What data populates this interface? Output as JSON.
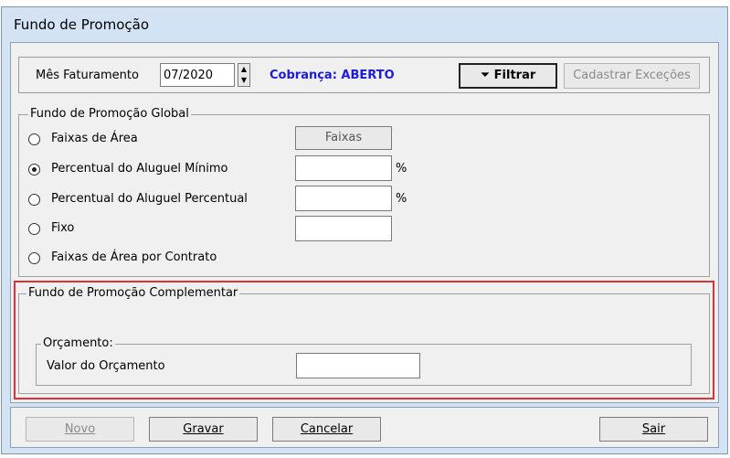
{
  "window": {
    "title": "Fundo de Promoção"
  },
  "filter_bar": {
    "month_label": "Mês Faturamento",
    "month_value": "07/2020",
    "status_text": "Cobrança: ABERTO",
    "filter_button": "Filtrar",
    "exceptions_button": "Cadastrar Exceções"
  },
  "global": {
    "legend": "Fundo de Promoção Global",
    "options": [
      {
        "label": "Faixas de Área",
        "selected": false
      },
      {
        "label": "Percentual do Aluguel Mínimo",
        "selected": true
      },
      {
        "label": "Percentual do Aluguel Percentual",
        "selected": false
      },
      {
        "label": "Fixo",
        "selected": false
      },
      {
        "label": "Faixas de Área por Contrato",
        "selected": false
      }
    ],
    "faixas_button": "Faixas",
    "percent_symbol": "%"
  },
  "complementar": {
    "legend": "Fundo de Promoção Complementar",
    "orcamento_legend": "Orçamento:",
    "valor_label": "Valor do Orçamento",
    "valor_value": ""
  },
  "buttons": {
    "novo": "Novo",
    "gravar": "Gravar",
    "cancelar": "Cancelar",
    "sair": "Sair"
  },
  "colors": {
    "status_blue": "#1b1bd9",
    "highlight_red": "#dd3333"
  }
}
